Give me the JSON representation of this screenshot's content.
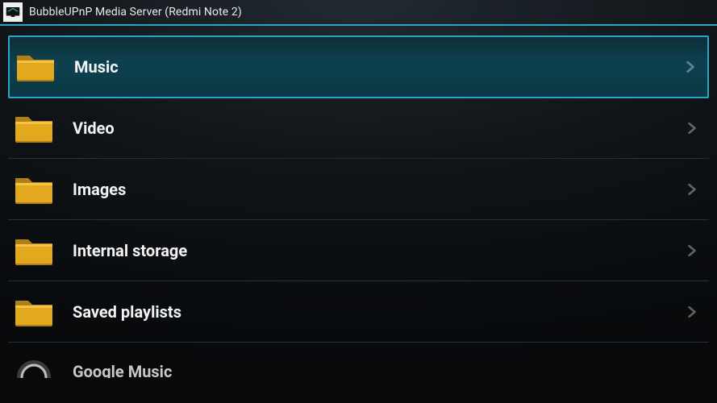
{
  "header": {
    "title": "BubbleUPnP Media Server (Redmi Note 2)"
  },
  "colors": {
    "accent": "#2aa6c5",
    "folder_fill": "#e3a91e",
    "folder_dark": "#b08015",
    "folder_hi": "#f5c24a"
  },
  "list": {
    "items": [
      {
        "label": "Music",
        "icon": "folder",
        "selected": true
      },
      {
        "label": "Video",
        "icon": "folder",
        "selected": false
      },
      {
        "label": "Images",
        "icon": "folder",
        "selected": false
      },
      {
        "label": "Internal storage",
        "icon": "folder",
        "selected": false
      },
      {
        "label": "Saved playlists",
        "icon": "folder",
        "selected": false
      },
      {
        "label": "Google Music",
        "icon": "headphones",
        "selected": false,
        "partial": true
      }
    ]
  }
}
